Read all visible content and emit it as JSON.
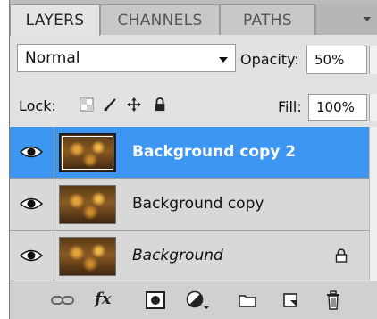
{
  "tabs": [
    {
      "label": "LAYERS",
      "active": true
    },
    {
      "label": "CHANNELS",
      "active": false
    },
    {
      "label": "PATHS",
      "active": false
    }
  ],
  "blend_mode": {
    "value": "Normal"
  },
  "opacity": {
    "label": "Opacity:",
    "value": "50%"
  },
  "lock": {
    "label": "Lock:",
    "icons": [
      "lock-transparent-icon",
      "lock-image-icon",
      "lock-position-icon",
      "lock-all-icon"
    ]
  },
  "fill": {
    "label": "Fill:",
    "value": "100%"
  },
  "layers": [
    {
      "name": "Background copy 2",
      "selected": true,
      "visible": true,
      "italic": false,
      "locked": false
    },
    {
      "name": "Background copy",
      "selected": false,
      "visible": true,
      "italic": false,
      "locked": false
    },
    {
      "name": "Background",
      "selected": false,
      "visible": true,
      "italic": true,
      "locked": true
    }
  ],
  "bottom_bar": {
    "icons": [
      "link-layers-icon",
      "fx-icon",
      "layer-mask-icon",
      "adjustment-layer-icon",
      "new-group-icon",
      "new-layer-icon",
      "trash-icon"
    ],
    "fx_label": "fx"
  },
  "colors": {
    "selection": "#3d97f2",
    "panel": "#d6d6d6"
  }
}
